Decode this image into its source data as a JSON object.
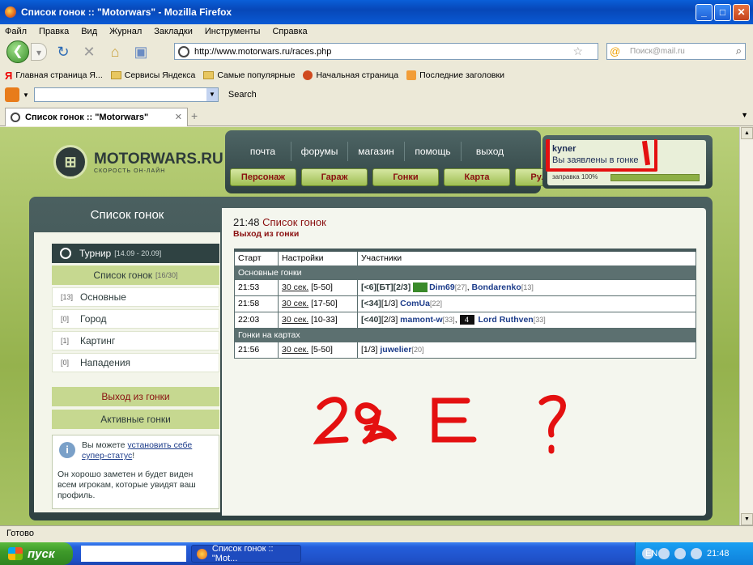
{
  "window": {
    "title": "Список гонок :: \"Motorwars\" - Mozilla Firefox",
    "min": "_",
    "max": "□",
    "close": "✕"
  },
  "menu": [
    "Файл",
    "Правка",
    "Вид",
    "Журнал",
    "Закладки",
    "Инструменты",
    "Справка"
  ],
  "nav": {
    "url": "http://www.motorwars.ru/races.php",
    "search_placeholder": "Поиск@mail.ru"
  },
  "bookmarks": [
    "Главная страница Я...",
    "Сервисы Яндекса",
    "Самые популярные",
    "Начальная страница",
    "Последние заголовки"
  ],
  "searchtoolbar": {
    "label": "Search"
  },
  "tab": {
    "title": "Список гонок :: \"Motorwars\""
  },
  "site": {
    "logo_name": "MOTORWARS.RU",
    "logo_slogan": "СКОРОСТЬ ОН-ЛАЙН",
    "top_links": [
      "почта",
      "форумы",
      "магазин",
      "помощь",
      "выход"
    ],
    "top_buttons": [
      "Персонаж",
      "Гараж",
      "Гонки",
      "Карта",
      "Рулетка"
    ],
    "user": {
      "name": "kyner",
      "note": "Вы заявлены в гонке",
      "fuel_label": "заправка 100%",
      "fuel_level": 100
    }
  },
  "left": {
    "title": "Список гонок",
    "turnir": {
      "label": "Турнир",
      "dates": "[14.09 - 20.09]"
    },
    "spisok": {
      "label": "Список гонок",
      "count": "[16/30]"
    },
    "categories": [
      {
        "count": "[13]",
        "label": "Основные"
      },
      {
        "count": "[0]",
        "label": "Город"
      },
      {
        "count": "[1]",
        "label": "Картинг"
      },
      {
        "count": "[0]",
        "label": "Нападения"
      }
    ],
    "exit": "Выход из гонки",
    "active": "Активные гонки",
    "info": {
      "p1_pre": "Вы можете ",
      "p1_link": "установить себе супер-статус",
      "p1_post": "!",
      "p2": "Он хорошо заметен и будет виден всем игрокам, которые увидят ваш профиль."
    }
  },
  "right": {
    "time": "21:48",
    "heading": "Список гонок",
    "exit_link": "Выход из гонки",
    "columns": [
      "Старт",
      "Настройки",
      "Участники"
    ],
    "group1": "Основные гонки",
    "group2": "Гонки на картах",
    "rows": [
      {
        "start": "21:53",
        "time": "30 сек.",
        "range": "[5-50]",
        "tag": "[<6][БТ][2/3]",
        "p1": "Dim69",
        "p1lvl": "[27]",
        "sep": ", ",
        "p2": "Bondarenko",
        "p2lvl": "[13]"
      },
      {
        "start": "21:58",
        "time": "30 сек.",
        "range": "[17-50]",
        "tag": "[<34]",
        "tag2": "[1/3]",
        "p1": "ComUa",
        "p1lvl": "[22]"
      },
      {
        "start": "22:03",
        "time": "30 сек.",
        "range": "[10-33]",
        "tag": "[<40]",
        "tag2": "[2/3]",
        "p1": "mamont-w",
        "p1lvl": "[33]",
        "sep": ",",
        "p2badge": "4",
        "p2": "Lord Ruthven",
        "p2lvl": "[33]"
      },
      {
        "start": "21:56",
        "time": "30 сек.",
        "range": "[5-50]",
        "tag2": "[1/3]",
        "p1": "juwelier",
        "p1lvl": "[20]"
      }
    ]
  },
  "scribble_text": "29 E ?",
  "status": "Готово",
  "taskbar": {
    "start": "пуск",
    "item": "Список гонок :: \"Mot...",
    "lang": "EN",
    "clock": "21:48"
  },
  "colors": {
    "accent_red": "#8a1010",
    "site_green": "#b9cf79",
    "panel_dark": "#2f4242",
    "scribble": "#e41010"
  }
}
